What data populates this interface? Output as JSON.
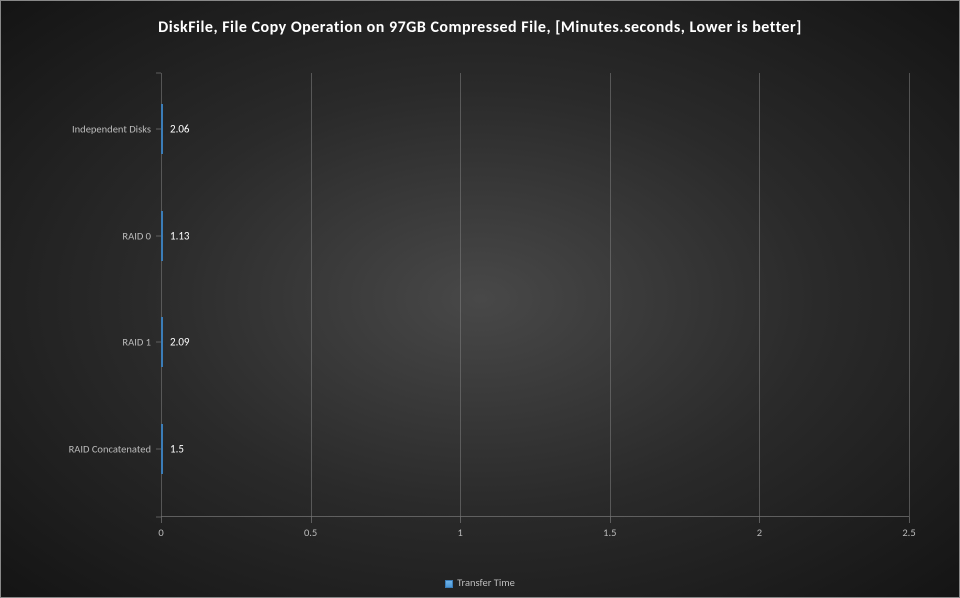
{
  "chart_data": {
    "type": "bar",
    "orientation": "horizontal",
    "title": "DiskFile, File Copy Operation on 97GB Compressed File, [Minutes.seconds, Lower is better]",
    "categories": [
      "Independent Disks",
      "RAID 0",
      "RAID 1",
      "RAID Concatenated"
    ],
    "values": [
      2.06,
      1.13,
      2.09,
      1.5
    ],
    "data_labels": [
      "2.06",
      "1.13",
      "2.09",
      "1.5"
    ],
    "series_name": "Transfer Time",
    "xlim": [
      0,
      2.5
    ],
    "xticks": [
      0,
      0.5,
      1,
      1.5,
      2,
      2.5
    ],
    "xtick_labels": [
      "0",
      "0.5",
      "1",
      "1.5",
      "2",
      "2.5"
    ],
    "xlabel": "",
    "ylabel": "",
    "legend_position": "bottom"
  }
}
